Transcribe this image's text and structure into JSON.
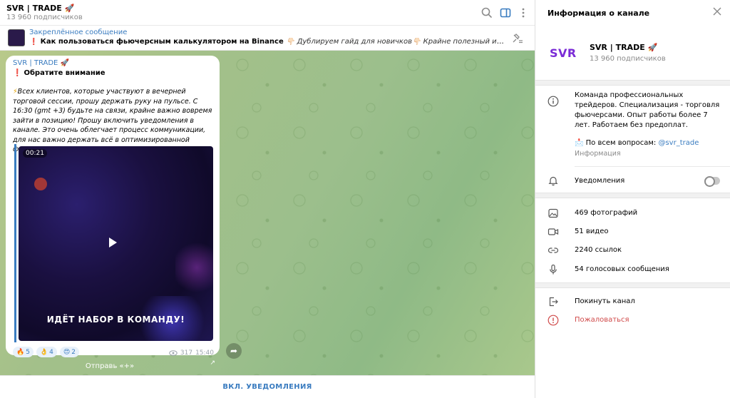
{
  "chat": {
    "title": "SVR | TRADE 🚀",
    "subscribers": "13 960 подписчиков",
    "pinned": {
      "header": "Закреплённое сообщение",
      "excl": "❗",
      "bold_text": "Как пользоваться фьючерсным калькулятором на Binance",
      "italic_text": "👇🏻 Дублируем гайд для новичков👇🏻  Крайне полезный инструмент, которым должен ум..."
    },
    "post": {
      "author": "SVR | TRADE 🚀",
      "excl": "❗",
      "heading": "Обратите внимание",
      "bolt": "⚡",
      "body": "Всех клиентов, которые участвуют в вечерней торговой сессии, прошу держать руку на пульсе. С 16:30 (gmt +3) будьте на связи, крайне важно вовремя зайти в позицию! Прошу включить уведомления в канале. Это очень облегчает процесс коммуникации, для нас важно держать всё в оптимизированной форме!",
      "video_duration": "00:21",
      "video_caption": "ИДЁТ НАБОР В КОМАНДУ!",
      "reactions": [
        {
          "emoji": "🔥",
          "count": "5"
        },
        {
          "emoji": "👌",
          "count": "4"
        },
        {
          "emoji": "😍",
          "count": "2"
        }
      ],
      "views": "317",
      "time": "15:40"
    },
    "forward_label": "Отправь «+»",
    "bottom_button": "ВКЛ. УВЕДОМЛЕНИЯ"
  },
  "panel": {
    "header": "Информация о канале",
    "avatar_text": "SVR",
    "name": "SVR | TRADE 🚀",
    "subscribers": "13 960 подписчиков",
    "description": "Команда профессиональных трейдеров. Специализация - торговля фьючерсами. Опыт работы более 7 лет. Работаем без предоплат.",
    "contact_prefix": "📩 По всем вопросам: ",
    "contact_handle": "@svr_trade",
    "info_label": "Информация",
    "notifications_label": "Уведомления",
    "notifications_on": false,
    "media": [
      {
        "icon": "photo-icon",
        "label": "469 фотографий"
      },
      {
        "icon": "video-icon",
        "label": "51 видео"
      },
      {
        "icon": "link-icon",
        "label": "2240 ссылок"
      },
      {
        "icon": "microphone-icon",
        "label": "54 голосовых сообщения"
      }
    ],
    "leave_label": "Покинуть канал",
    "report_label": "Пожаловаться"
  },
  "colors": {
    "accent": "#3a7cc0",
    "danger": "#d04a4a",
    "avatar_text": "#7a2bd6"
  }
}
